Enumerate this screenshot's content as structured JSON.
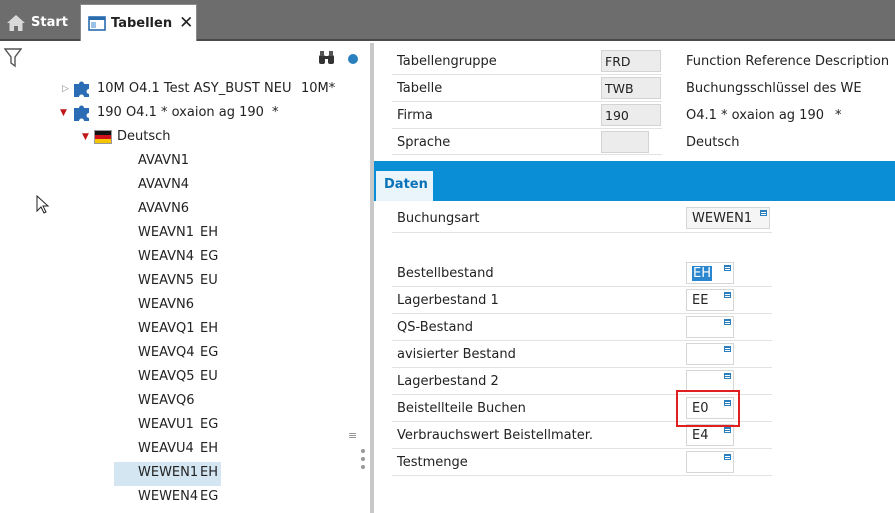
{
  "topbar": {
    "tabs": [
      {
        "label": "Start",
        "icon": "home-icon"
      },
      {
        "label": "Tabellen",
        "icon": "window-icon",
        "close": "✕"
      }
    ]
  },
  "left": {
    "tree": [
      {
        "label": "10M O4.1 Test ASY_BUST NEU",
        "suffix": "10M*"
      },
      {
        "label": "190 O4.1 * oxaion ag 190",
        "suffix": "*"
      },
      {
        "label": "Deutsch"
      }
    ],
    "entries": [
      {
        "code": "AVAVN1",
        "extra": ""
      },
      {
        "code": "AVAVN4",
        "extra": ""
      },
      {
        "code": "AVAVN6",
        "extra": ""
      },
      {
        "code": "WEAVN1",
        "extra": "EH"
      },
      {
        "code": "WEAVN4",
        "extra": "EG"
      },
      {
        "code": "WEAVN5",
        "extra": "EU"
      },
      {
        "code": "WEAVN6",
        "extra": ""
      },
      {
        "code": "WEAVQ1",
        "extra": "EH"
      },
      {
        "code": "WEAVQ4",
        "extra": "EG"
      },
      {
        "code": "WEAVQ5",
        "extra": "EU"
      },
      {
        "code": "WEAVQ6",
        "extra": ""
      },
      {
        "code": "WEAVU1",
        "extra": "EG"
      },
      {
        "code": "WEAVU4",
        "extra": "EH"
      },
      {
        "code": "WEWEN1",
        "extra": "EH"
      },
      {
        "code": "WEWEN4",
        "extra": "EG"
      }
    ],
    "selected_index": 13
  },
  "right": {
    "header": [
      {
        "label": "Tabellengruppe",
        "value": "FRD",
        "desc": "Function Reference Description"
      },
      {
        "label": "Tabelle",
        "value": "TWB",
        "desc": "Buchungsschlüssel des WE"
      },
      {
        "label": "Firma",
        "value": "190",
        "desc": "O4.1 * oxaion ag 190",
        "desc_suffix": "*"
      },
      {
        "label": "Sprache",
        "value": "",
        "desc": "Deutsch"
      }
    ],
    "tab": "Daten",
    "buchungsart": {
      "label": "Buchungsart",
      "value": "WEWEN1"
    },
    "fields": [
      {
        "label": "Bestellbestand",
        "value": "EH"
      },
      {
        "label": "Lagerbestand 1",
        "value": "EE"
      },
      {
        "label": "QS-Bestand",
        "value": ""
      },
      {
        "label": "avisierter Bestand",
        "value": ""
      },
      {
        "label": "Lagerbestand 2",
        "value": ""
      },
      {
        "label": "Beistellteile Buchen",
        "value": "E0"
      },
      {
        "label": "Verbrauchswert Beistellmater.",
        "value": "E4"
      },
      {
        "label": "Testmenge",
        "value": ""
      }
    ]
  },
  "colors": {
    "accent": "#0a8fd6",
    "highlight_border": "#e02020",
    "topbar": "#6d6d6d",
    "selection": "#d4e6f2"
  }
}
